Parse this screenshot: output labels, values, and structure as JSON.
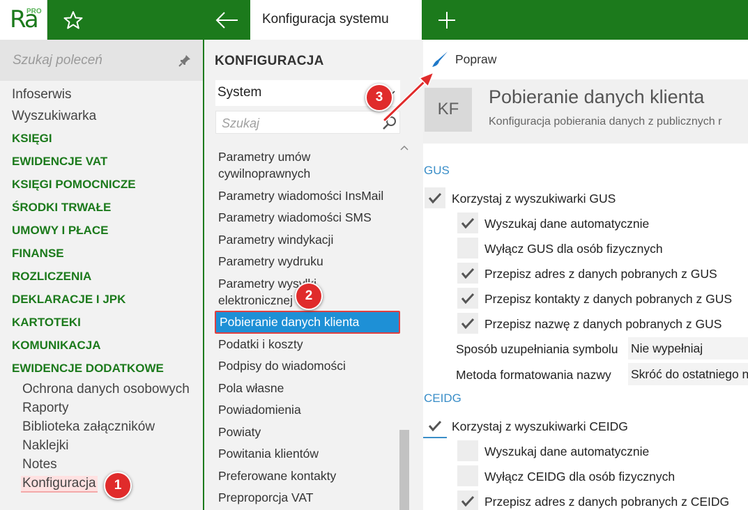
{
  "app": {
    "logo_text": "Ra",
    "logo_badge": "PRO",
    "tab_title": "Konfiguracja systemu",
    "brand_color": "#1c7a1c"
  },
  "sidebar": {
    "search_placeholder": "Szukaj poleceń",
    "top_items": [
      "Infoserwis",
      "Wyszukiwarka"
    ],
    "groups": [
      "KSIĘGI",
      "EWIDENCJE VAT",
      "KSIĘGI POMOCNICZE",
      "ŚRODKI TRWAŁE",
      "UMOWY I PŁACE",
      "FINANSE",
      "ROZLICZENIA",
      "DEKLARACJE I JPK",
      "KARTOTEKI",
      "KOMUNIKACJA",
      "EWIDENCJE DODATKOWE"
    ],
    "sub_items": [
      "Ochrona danych osobowych",
      "Raporty",
      "Biblioteka załączników",
      "Naklejki",
      "Notes",
      "Konfiguracja"
    ]
  },
  "config_panel": {
    "title": "KONFIGURACJA",
    "selected_category": "System",
    "search_placeholder": "Szukaj",
    "items": [
      "Parametry umów cywilnoprawnych",
      "Parametry wiadomości InsMail",
      "Parametry wiadomości SMS",
      "Parametry windykacji",
      "Parametry wydruku",
      "Parametry wysyłki elektronicznej",
      "Pobieranie danych klienta",
      "Podatki i koszty",
      "Podpisy do wiadomości",
      "Pola własne",
      "Powiadomienia",
      "Powiaty",
      "Powitania klientów",
      "Preferowane kontakty",
      "Preproporcja VAT"
    ],
    "selected_item": "Pobieranie danych klienta"
  },
  "content": {
    "toolbar_button": "Popraw",
    "badge": "KF",
    "title": "Pobieranie danych klienta",
    "subtitle": "Konfiguracja pobierania danych z publicznych r",
    "gus": {
      "section_title": "GUS",
      "main_label": "Korzystaj z wyszukiwarki GUS",
      "main_checked": true,
      "options": [
        {
          "label": "Wyszukaj dane automatycznie",
          "checked": true
        },
        {
          "label": "Wyłącz GUS dla osób fizycznych",
          "checked": false
        },
        {
          "label": "Przepisz adres z danych pobranych z GUS",
          "checked": true
        },
        {
          "label": "Przepisz kontakty z danych pobranych z GUS",
          "checked": true
        },
        {
          "label": "Przepisz nazwę z danych pobranych z GUS",
          "checked": true
        }
      ],
      "fields": [
        {
          "label": "Sposób uzupełniania symbolu",
          "value": "Nie wypełniaj"
        },
        {
          "label": "Metoda formatowania nazwy",
          "value": "Skróć do ostatniego n"
        }
      ]
    },
    "ceidg": {
      "section_title": "CEIDG",
      "main_label": "Korzystaj z wyszukiwarki CEIDG",
      "main_checked": true,
      "options": [
        {
          "label": "Wyszukaj dane automatycznie",
          "checked": false
        },
        {
          "label": "Wyłącz CEIDG dla osób fizycznych",
          "checked": false
        },
        {
          "label": "Przepisz adres z danych pobranych z CEIDG",
          "checked": true
        }
      ]
    }
  },
  "callouts": [
    "1",
    "2",
    "3"
  ],
  "icons": {
    "star": "star-icon",
    "back": "arrow-left-icon",
    "plus": "plus-icon",
    "pin": "pin-icon",
    "search": "search-icon",
    "brush": "brush-icon",
    "check": "checkmark-icon"
  }
}
